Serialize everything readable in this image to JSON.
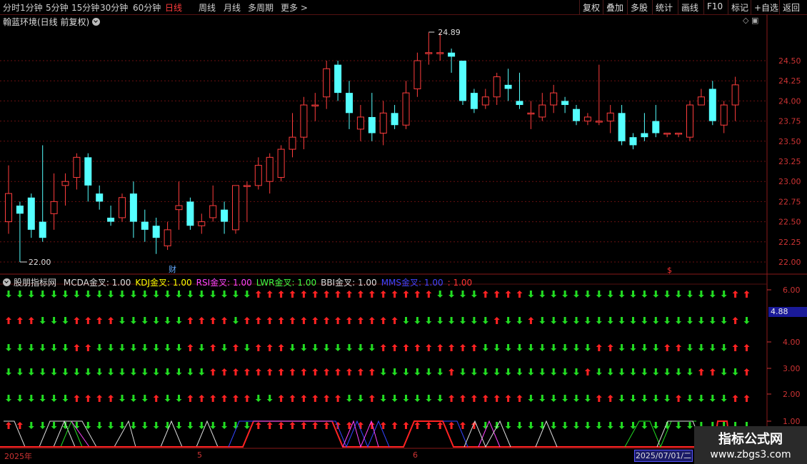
{
  "toolbar": {
    "left": [
      "分时",
      "1分钟",
      "5分钟",
      "15分钟",
      "30分钟",
      "60分钟",
      "日线",
      "周线",
      "月线",
      "多周期",
      "更多 >"
    ],
    "active": "日线",
    "right": [
      "复权",
      "叠加",
      "多股",
      "统计",
      "画线",
      "F10",
      "标记",
      "+自选",
      "返回"
    ]
  },
  "title": "翰蓝环境(日线 前复权)",
  "price_axis": [
    "24.50",
    "24.25",
    "24.00",
    "23.75",
    "23.50",
    "23.25",
    "23.00",
    "22.75",
    "22.50",
    "22.25",
    "22.00"
  ],
  "annotations": {
    "high": "24.89",
    "low": "22.00",
    "cai": "财",
    "dollar": "$"
  },
  "indicator": {
    "name": "股朋指标网",
    "items": [
      {
        "label": "MCDA金叉: 1.00",
        "color": "#dddddd"
      },
      {
        "label": "KDJ金叉: 1.00",
        "color": "#ffff00"
      },
      {
        "label": "RSI金叉: 1.00",
        "color": "#ff44ff"
      },
      {
        "label": "LWR金叉: 1.00",
        "color": "#44ff44"
      },
      {
        "label": "BBI金叉: 1.00",
        "color": "#dddddd"
      },
      {
        "label": "MMS金叉: 1.00",
        "color": "#4444ff"
      },
      {
        "label": ": 1.00",
        "color": "#ff3333"
      }
    ],
    "axis": [
      "6.00",
      "4.00",
      "3.00",
      "2.00",
      "1.00"
    ],
    "current": "4.88"
  },
  "dates": {
    "d1": "2025年",
    "d2": "5",
    "d3": "6",
    "cursor": "2025/07/01/二"
  },
  "watermark": {
    "line1": "指标公式网",
    "line2": "www.zbgs3.com"
  },
  "chart_data": {
    "type": "candlestick",
    "ylim": [
      22.0,
      24.89
    ],
    "candles": [
      [
        22.5,
        22.85,
        22.35,
        23.2
      ],
      [
        22.7,
        22.6,
        22.0,
        22.75
      ],
      [
        22.8,
        22.4,
        22.3,
        22.85
      ],
      [
        22.5,
        22.3,
        22.25,
        23.45
      ],
      [
        22.6,
        22.75,
        22.4,
        23.1
      ],
      [
        22.95,
        23.0,
        22.7,
        23.1
      ],
      [
        23.05,
        23.3,
        22.9,
        23.35
      ],
      [
        23.3,
        22.95,
        22.75,
        23.35
      ],
      [
        22.85,
        22.75,
        22.65,
        22.95
      ],
      [
        22.55,
        22.5,
        22.45,
        22.7
      ],
      [
        22.55,
        22.8,
        22.5,
        22.85
      ],
      [
        22.85,
        22.5,
        22.3,
        23.0
      ],
      [
        22.5,
        22.4,
        22.25,
        22.65
      ],
      [
        22.45,
        22.3,
        22.1,
        22.55
      ],
      [
        22.2,
        22.4,
        22.15,
        22.5
      ],
      [
        22.65,
        22.7,
        22.4,
        23.0
      ],
      [
        22.75,
        22.45,
        22.4,
        22.8
      ],
      [
        22.45,
        22.5,
        22.35,
        22.6
      ],
      [
        22.55,
        22.7,
        22.5,
        22.95
      ],
      [
        22.65,
        22.5,
        22.35,
        22.75
      ],
      [
        22.4,
        22.95,
        22.35,
        22.95
      ],
      [
        22.95,
        22.95,
        22.5,
        23.0
      ],
      [
        22.95,
        23.2,
        22.9,
        23.3
      ],
      [
        23.0,
        23.3,
        22.85,
        23.35
      ],
      [
        23.05,
        23.4,
        23.0,
        23.45
      ],
      [
        23.4,
        23.55,
        23.3,
        23.85
      ],
      [
        23.55,
        23.95,
        23.4,
        24.05
      ],
      [
        23.95,
        23.95,
        23.75,
        24.1
      ],
      [
        24.05,
        24.4,
        23.9,
        24.5
      ],
      [
        24.45,
        24.1,
        24.0,
        24.5
      ],
      [
        24.1,
        23.85,
        23.65,
        24.25
      ],
      [
        23.65,
        23.8,
        23.5,
        23.95
      ],
      [
        23.8,
        23.6,
        23.5,
        24.1
      ],
      [
        23.6,
        23.85,
        23.45,
        24.0
      ],
      [
        23.85,
        23.7,
        23.65,
        23.95
      ],
      [
        23.7,
        24.1,
        23.65,
        24.25
      ],
      [
        24.15,
        24.5,
        24.05,
        24.6
      ],
      [
        24.6,
        24.6,
        24.45,
        24.85
      ],
      [
        24.6,
        24.6,
        24.5,
        24.85
      ],
      [
        24.6,
        24.55,
        24.35,
        24.65
      ],
      [
        24.5,
        24.0,
        23.95,
        24.5
      ],
      [
        24.1,
        23.9,
        23.85,
        24.15
      ],
      [
        23.95,
        24.05,
        23.9,
        24.15
      ],
      [
        24.05,
        24.3,
        23.95,
        24.35
      ],
      [
        24.2,
        24.15,
        24.0,
        24.4
      ],
      [
        24.0,
        23.95,
        23.9,
        24.35
      ],
      [
        23.85,
        23.85,
        23.65,
        24.0
      ],
      [
        23.8,
        23.95,
        23.75,
        24.1
      ],
      [
        23.95,
        24.1,
        23.85,
        24.2
      ],
      [
        24.0,
        23.95,
        23.85,
        24.05
      ],
      [
        23.9,
        23.75,
        23.7,
        23.95
      ],
      [
        23.75,
        23.8,
        23.7,
        23.85
      ],
      [
        23.75,
        23.75,
        23.7,
        24.45
      ],
      [
        23.75,
        23.85,
        23.6,
        23.95
      ],
      [
        23.85,
        23.5,
        23.45,
        23.95
      ],
      [
        23.55,
        23.45,
        23.4,
        23.6
      ],
      [
        23.6,
        23.55,
        23.5,
        23.85
      ],
      [
        23.75,
        23.6,
        23.55,
        23.95
      ],
      [
        23.6,
        23.6,
        23.55,
        23.6
      ],
      [
        23.6,
        23.6,
        23.55,
        23.6
      ],
      [
        23.55,
        23.95,
        23.5,
        24.0
      ],
      [
        23.95,
        24.05,
        23.95,
        24.15
      ],
      [
        24.15,
        23.75,
        23.7,
        24.25
      ],
      [
        23.7,
        23.95,
        23.6,
        24.0
      ],
      [
        23.95,
        24.2,
        23.75,
        24.3
      ]
    ]
  }
}
